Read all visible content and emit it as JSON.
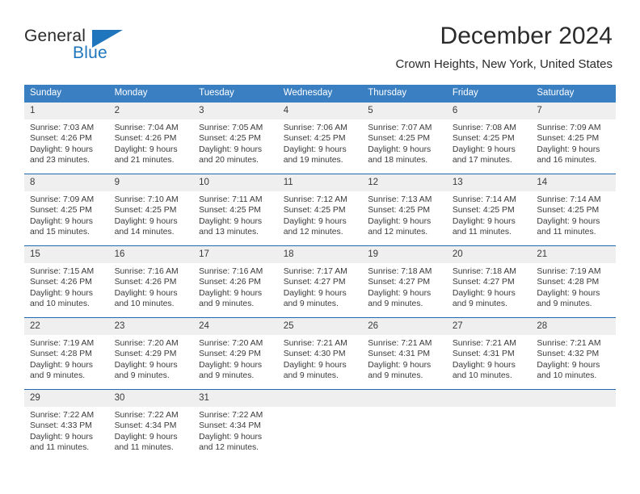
{
  "brand": {
    "name_part1": "General",
    "name_part2": "Blue",
    "accent_color": "#1f76bc"
  },
  "header": {
    "month_title": "December 2024",
    "location": "Crown Heights, New York, United States"
  },
  "calendar": {
    "header_bg": "#3a7fc1",
    "daynum_bg": "#efefef",
    "separator_color": "#1f6aae",
    "weekday_headers": [
      "Sunday",
      "Monday",
      "Tuesday",
      "Wednesday",
      "Thursday",
      "Friday",
      "Saturday"
    ],
    "weeks": [
      [
        {
          "day": "1",
          "sunrise": "Sunrise: 7:03 AM",
          "sunset": "Sunset: 4:26 PM",
          "daylight_line1": "Daylight: 9 hours",
          "daylight_line2": "and 23 minutes."
        },
        {
          "day": "2",
          "sunrise": "Sunrise: 7:04 AM",
          "sunset": "Sunset: 4:26 PM",
          "daylight_line1": "Daylight: 9 hours",
          "daylight_line2": "and 21 minutes."
        },
        {
          "day": "3",
          "sunrise": "Sunrise: 7:05 AM",
          "sunset": "Sunset: 4:25 PM",
          "daylight_line1": "Daylight: 9 hours",
          "daylight_line2": "and 20 minutes."
        },
        {
          "day": "4",
          "sunrise": "Sunrise: 7:06 AM",
          "sunset": "Sunset: 4:25 PM",
          "daylight_line1": "Daylight: 9 hours",
          "daylight_line2": "and 19 minutes."
        },
        {
          "day": "5",
          "sunrise": "Sunrise: 7:07 AM",
          "sunset": "Sunset: 4:25 PM",
          "daylight_line1": "Daylight: 9 hours",
          "daylight_line2": "and 18 minutes."
        },
        {
          "day": "6",
          "sunrise": "Sunrise: 7:08 AM",
          "sunset": "Sunset: 4:25 PM",
          "daylight_line1": "Daylight: 9 hours",
          "daylight_line2": "and 17 minutes."
        },
        {
          "day": "7",
          "sunrise": "Sunrise: 7:09 AM",
          "sunset": "Sunset: 4:25 PM",
          "daylight_line1": "Daylight: 9 hours",
          "daylight_line2": "and 16 minutes."
        }
      ],
      [
        {
          "day": "8",
          "sunrise": "Sunrise: 7:09 AM",
          "sunset": "Sunset: 4:25 PM",
          "daylight_line1": "Daylight: 9 hours",
          "daylight_line2": "and 15 minutes."
        },
        {
          "day": "9",
          "sunrise": "Sunrise: 7:10 AM",
          "sunset": "Sunset: 4:25 PM",
          "daylight_line1": "Daylight: 9 hours",
          "daylight_line2": "and 14 minutes."
        },
        {
          "day": "10",
          "sunrise": "Sunrise: 7:11 AM",
          "sunset": "Sunset: 4:25 PM",
          "daylight_line1": "Daylight: 9 hours",
          "daylight_line2": "and 13 minutes."
        },
        {
          "day": "11",
          "sunrise": "Sunrise: 7:12 AM",
          "sunset": "Sunset: 4:25 PM",
          "daylight_line1": "Daylight: 9 hours",
          "daylight_line2": "and 12 minutes."
        },
        {
          "day": "12",
          "sunrise": "Sunrise: 7:13 AM",
          "sunset": "Sunset: 4:25 PM",
          "daylight_line1": "Daylight: 9 hours",
          "daylight_line2": "and 12 minutes."
        },
        {
          "day": "13",
          "sunrise": "Sunrise: 7:14 AM",
          "sunset": "Sunset: 4:25 PM",
          "daylight_line1": "Daylight: 9 hours",
          "daylight_line2": "and 11 minutes."
        },
        {
          "day": "14",
          "sunrise": "Sunrise: 7:14 AM",
          "sunset": "Sunset: 4:25 PM",
          "daylight_line1": "Daylight: 9 hours",
          "daylight_line2": "and 11 minutes."
        }
      ],
      [
        {
          "day": "15",
          "sunrise": "Sunrise: 7:15 AM",
          "sunset": "Sunset: 4:26 PM",
          "daylight_line1": "Daylight: 9 hours",
          "daylight_line2": "and 10 minutes."
        },
        {
          "day": "16",
          "sunrise": "Sunrise: 7:16 AM",
          "sunset": "Sunset: 4:26 PM",
          "daylight_line1": "Daylight: 9 hours",
          "daylight_line2": "and 10 minutes."
        },
        {
          "day": "17",
          "sunrise": "Sunrise: 7:16 AM",
          "sunset": "Sunset: 4:26 PM",
          "daylight_line1": "Daylight: 9 hours",
          "daylight_line2": "and 9 minutes."
        },
        {
          "day": "18",
          "sunrise": "Sunrise: 7:17 AM",
          "sunset": "Sunset: 4:27 PM",
          "daylight_line1": "Daylight: 9 hours",
          "daylight_line2": "and 9 minutes."
        },
        {
          "day": "19",
          "sunrise": "Sunrise: 7:18 AM",
          "sunset": "Sunset: 4:27 PM",
          "daylight_line1": "Daylight: 9 hours",
          "daylight_line2": "and 9 minutes."
        },
        {
          "day": "20",
          "sunrise": "Sunrise: 7:18 AM",
          "sunset": "Sunset: 4:27 PM",
          "daylight_line1": "Daylight: 9 hours",
          "daylight_line2": "and 9 minutes."
        },
        {
          "day": "21",
          "sunrise": "Sunrise: 7:19 AM",
          "sunset": "Sunset: 4:28 PM",
          "daylight_line1": "Daylight: 9 hours",
          "daylight_line2": "and 9 minutes."
        }
      ],
      [
        {
          "day": "22",
          "sunrise": "Sunrise: 7:19 AM",
          "sunset": "Sunset: 4:28 PM",
          "daylight_line1": "Daylight: 9 hours",
          "daylight_line2": "and 9 minutes."
        },
        {
          "day": "23",
          "sunrise": "Sunrise: 7:20 AM",
          "sunset": "Sunset: 4:29 PM",
          "daylight_line1": "Daylight: 9 hours",
          "daylight_line2": "and 9 minutes."
        },
        {
          "day": "24",
          "sunrise": "Sunrise: 7:20 AM",
          "sunset": "Sunset: 4:29 PM",
          "daylight_line1": "Daylight: 9 hours",
          "daylight_line2": "and 9 minutes."
        },
        {
          "day": "25",
          "sunrise": "Sunrise: 7:21 AM",
          "sunset": "Sunset: 4:30 PM",
          "daylight_line1": "Daylight: 9 hours",
          "daylight_line2": "and 9 minutes."
        },
        {
          "day": "26",
          "sunrise": "Sunrise: 7:21 AM",
          "sunset": "Sunset: 4:31 PM",
          "daylight_line1": "Daylight: 9 hours",
          "daylight_line2": "and 9 minutes."
        },
        {
          "day": "27",
          "sunrise": "Sunrise: 7:21 AM",
          "sunset": "Sunset: 4:31 PM",
          "daylight_line1": "Daylight: 9 hours",
          "daylight_line2": "and 10 minutes."
        },
        {
          "day": "28",
          "sunrise": "Sunrise: 7:21 AM",
          "sunset": "Sunset: 4:32 PM",
          "daylight_line1": "Daylight: 9 hours",
          "daylight_line2": "and 10 minutes."
        }
      ],
      [
        {
          "day": "29",
          "sunrise": "Sunrise: 7:22 AM",
          "sunset": "Sunset: 4:33 PM",
          "daylight_line1": "Daylight: 9 hours",
          "daylight_line2": "and 11 minutes."
        },
        {
          "day": "30",
          "sunrise": "Sunrise: 7:22 AM",
          "sunset": "Sunset: 4:34 PM",
          "daylight_line1": "Daylight: 9 hours",
          "daylight_line2": "and 11 minutes."
        },
        {
          "day": "31",
          "sunrise": "Sunrise: 7:22 AM",
          "sunset": "Sunset: 4:34 PM",
          "daylight_line1": "Daylight: 9 hours",
          "daylight_line2": "and 12 minutes."
        },
        {
          "day": "",
          "sunrise": "",
          "sunset": "",
          "daylight_line1": "",
          "daylight_line2": ""
        },
        {
          "day": "",
          "sunrise": "",
          "sunset": "",
          "daylight_line1": "",
          "daylight_line2": ""
        },
        {
          "day": "",
          "sunrise": "",
          "sunset": "",
          "daylight_line1": "",
          "daylight_line2": ""
        },
        {
          "day": "",
          "sunrise": "",
          "sunset": "",
          "daylight_line1": "",
          "daylight_line2": ""
        }
      ]
    ]
  }
}
